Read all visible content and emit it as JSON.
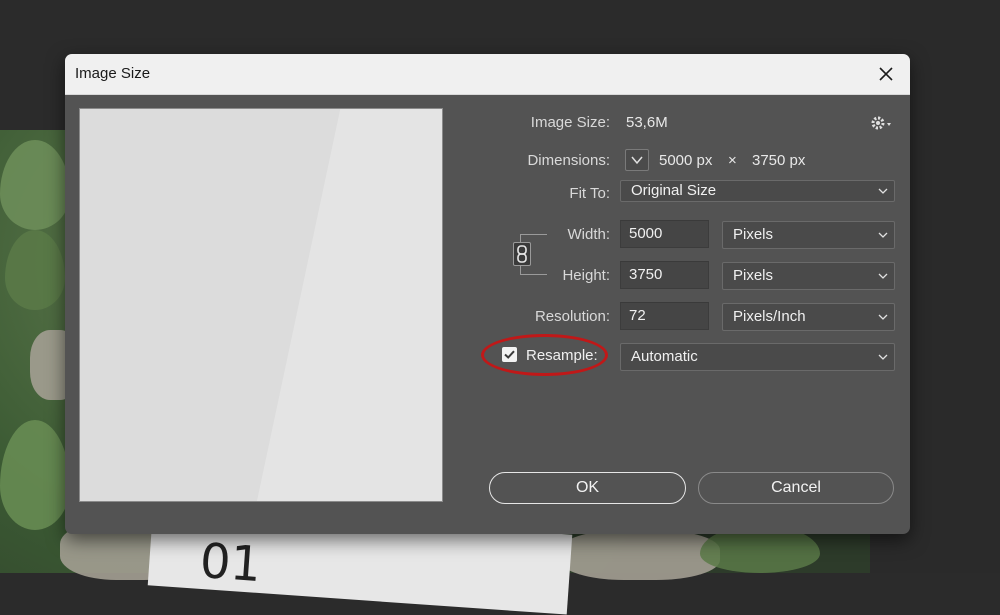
{
  "dialog": {
    "title": "Image Size",
    "image_size_label": "Image Size:",
    "image_size_value": "53,6M",
    "dimensions_label": "Dimensions:",
    "dimensions_width": "5000 px",
    "dimensions_sep": "×",
    "dimensions_height": "3750 px",
    "fit_to_label": "Fit To:",
    "fit_to_value": "Original Size",
    "width_label": "Width:",
    "width_value": "5000",
    "width_unit": "Pixels",
    "height_label": "Height:",
    "height_value": "3750",
    "height_unit": "Pixels",
    "resolution_label": "Resolution:",
    "resolution_value": "72",
    "resolution_unit": "Pixels/Inch",
    "resample_label": "Resample:",
    "resample_checked": true,
    "resample_value": "Automatic",
    "ok_label": "OK",
    "cancel_label": "Cancel"
  },
  "background": {
    "paper_text": "01"
  },
  "colors": {
    "dialog_bg": "#535353",
    "highlight": "#c01818"
  }
}
